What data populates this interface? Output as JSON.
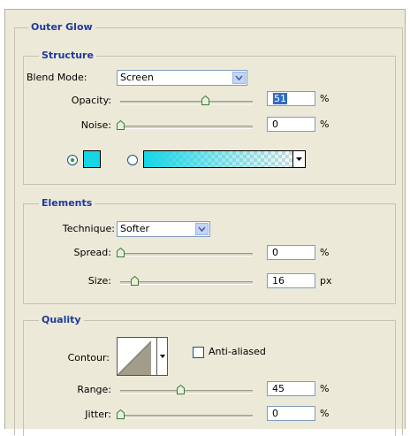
{
  "outer_glow": {
    "title": "Outer Glow",
    "structure": {
      "title": "Structure",
      "blend_mode_label": "Blend Mode:",
      "blend_mode_value": "Screen",
      "opacity_label": "Opacity:",
      "opacity_value": "51",
      "opacity_unit": "%",
      "opacity_level": 0.51,
      "noise_label": "Noise:",
      "noise_value": "0",
      "noise_unit": "%",
      "noise_level": 0.0,
      "color_swatch": "#14d6e6",
      "gradient_from": "#14d6e6",
      "gradient_to": "transparent"
    },
    "elements": {
      "title": "Elements",
      "technique_label": "Technique:",
      "technique_value": "Softer",
      "spread_label": "Spread:",
      "spread_value": "0",
      "spread_unit": "%",
      "size_label": "Size:",
      "size_value": "16",
      "size_unit": "px"
    },
    "quality": {
      "title": "Quality",
      "contour_label": "Contour:",
      "anti_aliased_label": "Anti-aliased",
      "anti_aliased_checked": false,
      "range_label": "Range:",
      "range_value": "45",
      "range_unit": "%",
      "range_level": 0.45,
      "jitter_label": "Jitter:",
      "jitter_value": "0",
      "jitter_unit": "%",
      "jitter_level": 0.0
    }
  },
  "colors": {
    "panel_bg": "#ece9d8",
    "title_text": "#1f3a9c",
    "selection_bg": "#316ac5",
    "accent_cyan": "#14d6e6"
  }
}
